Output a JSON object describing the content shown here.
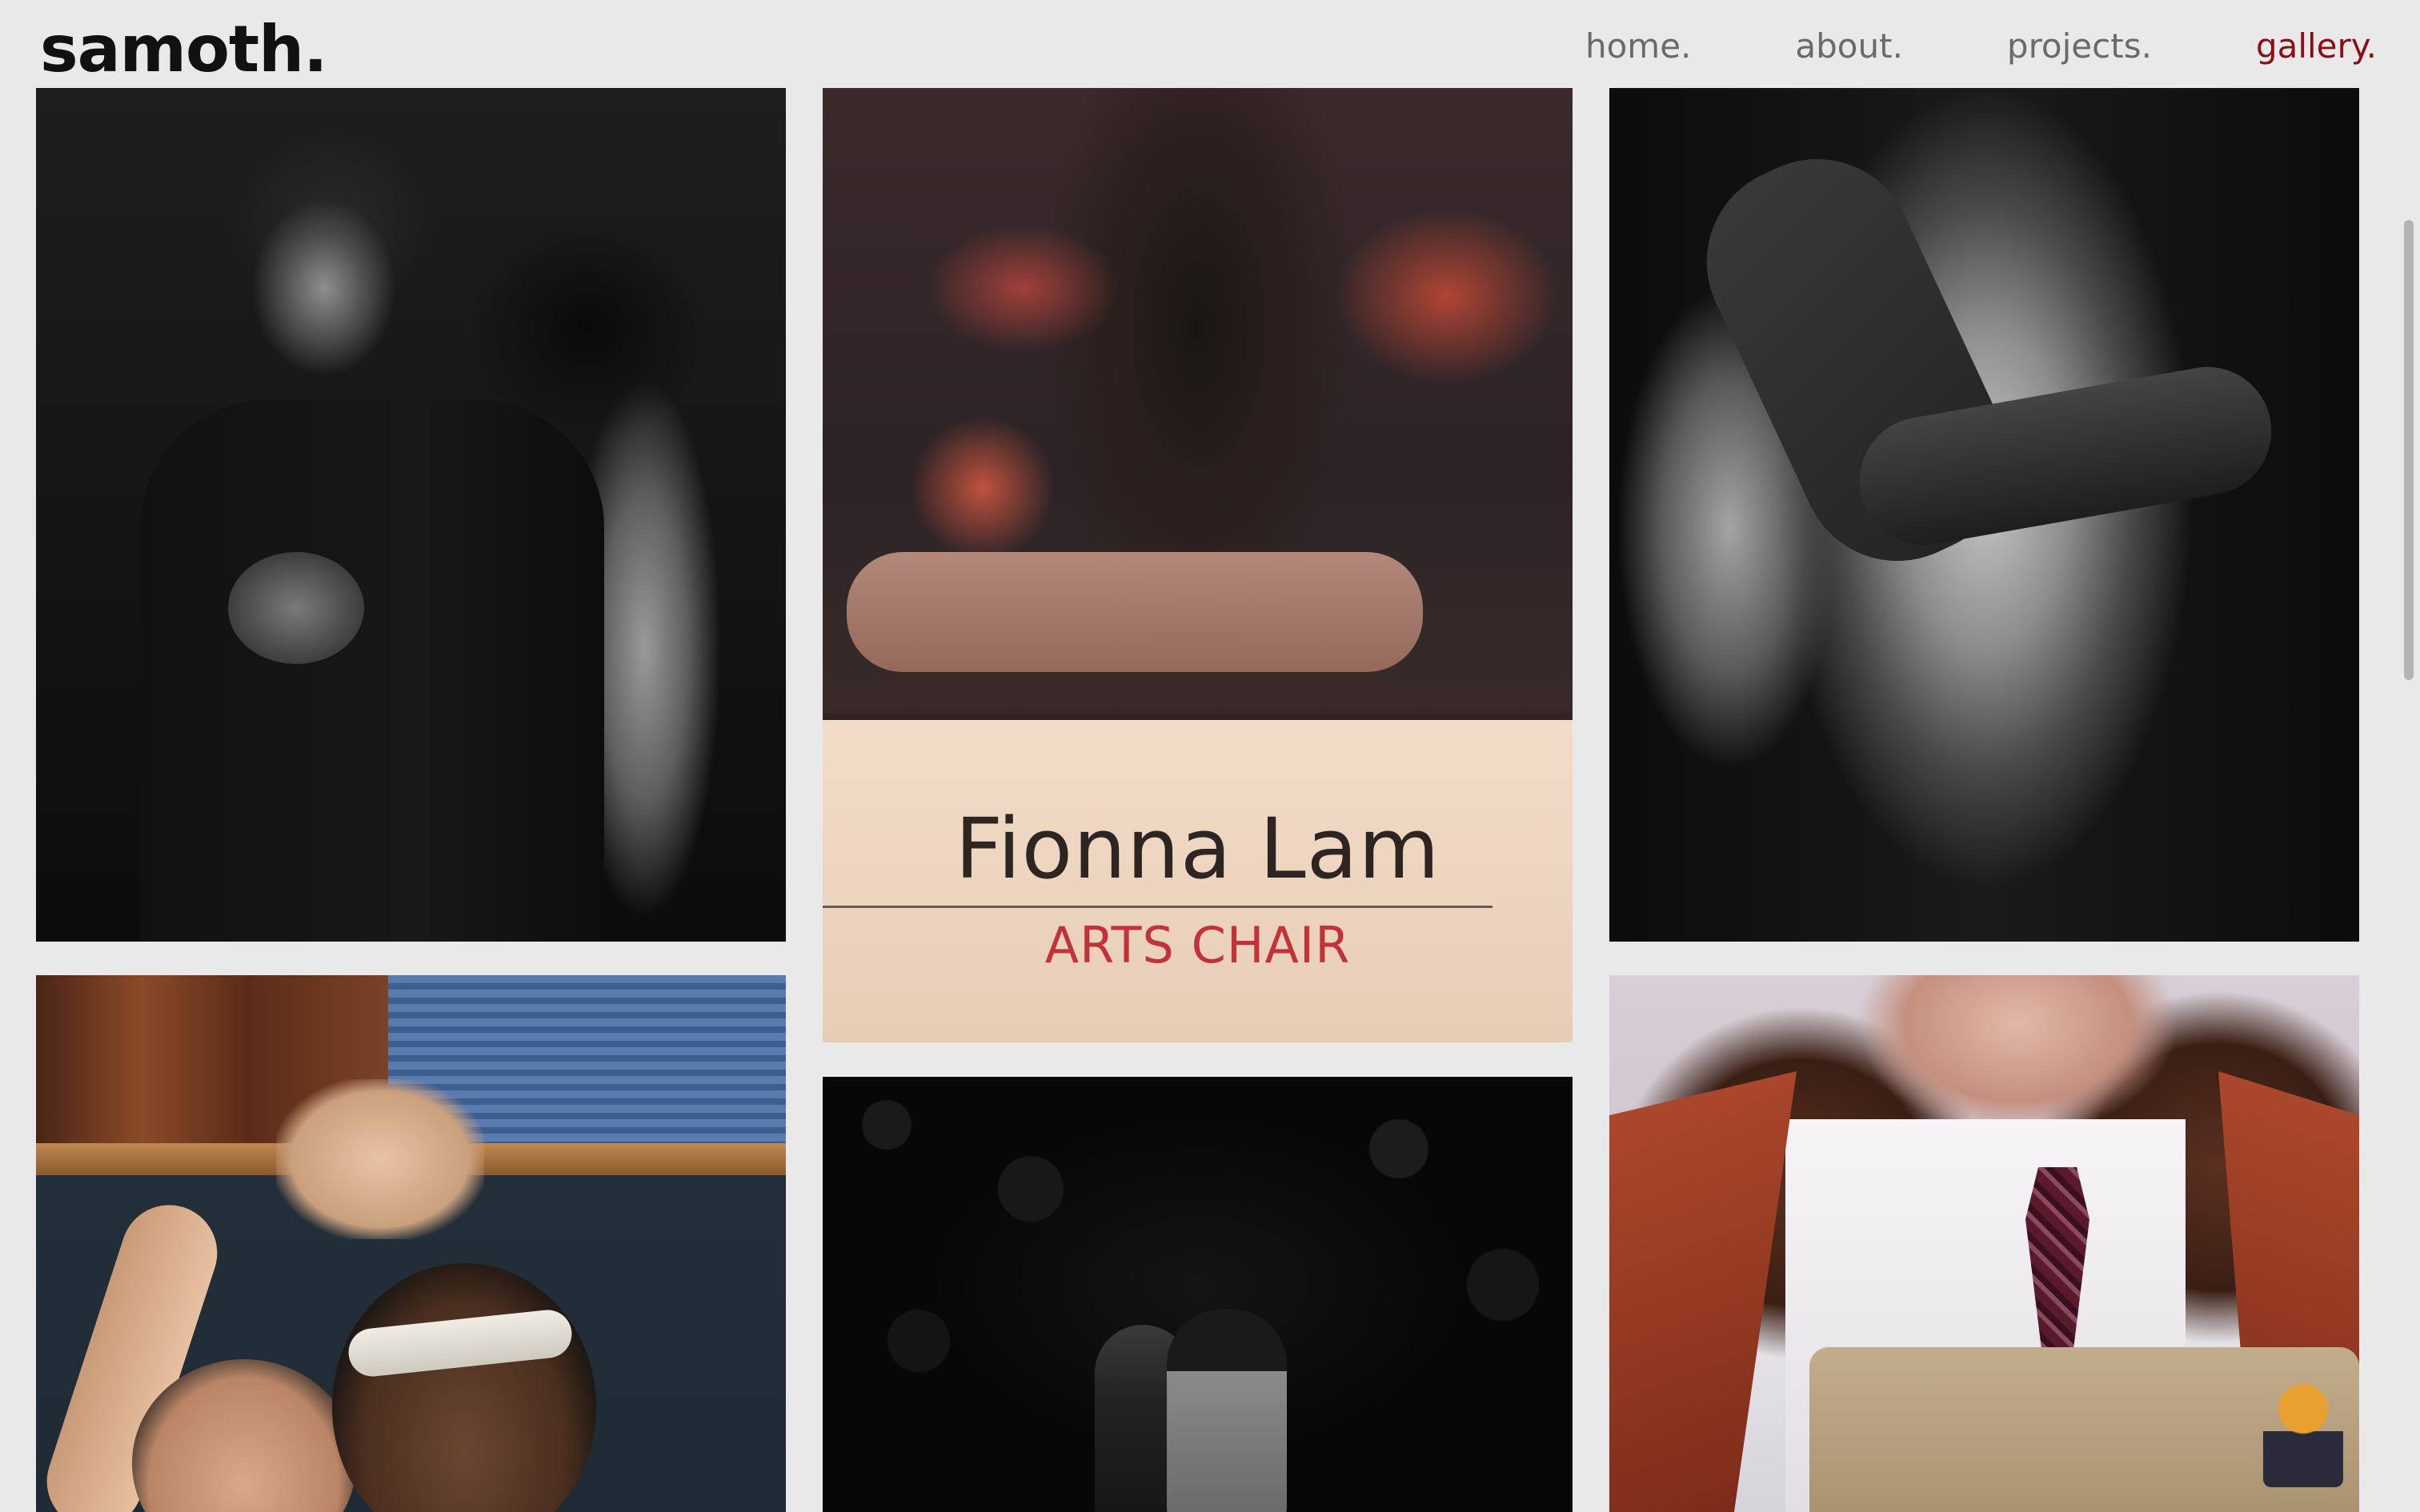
{
  "header": {
    "logo": "samoth.",
    "nav": [
      {
        "label": "home.",
        "active": false
      },
      {
        "label": "about.",
        "active": false
      },
      {
        "label": "projects.",
        "active": false
      },
      {
        "label": "gallery.",
        "active": true
      }
    ]
  },
  "gallery": {
    "photos": [
      {
        "subject": "black-and-white portrait of two people in foliage"
      },
      {
        "subject": "person at desk with name card",
        "card": {
          "name": "Fionna Lam",
          "role": "ARTS CHAIR"
        }
      },
      {
        "subject": "black-and-white embrace in silk shirts"
      },
      {
        "subject": "two friends making a heart with hands in classroom"
      },
      {
        "subject": "two small figures in dark foliage"
      },
      {
        "subject": "person in red jacket and tie behind laptop"
      }
    ]
  },
  "colors": {
    "background": "#e9e9e9",
    "nav_inactive": "#6a6a6a",
    "nav_active": "#8a0e14",
    "logo": "#111111"
  }
}
